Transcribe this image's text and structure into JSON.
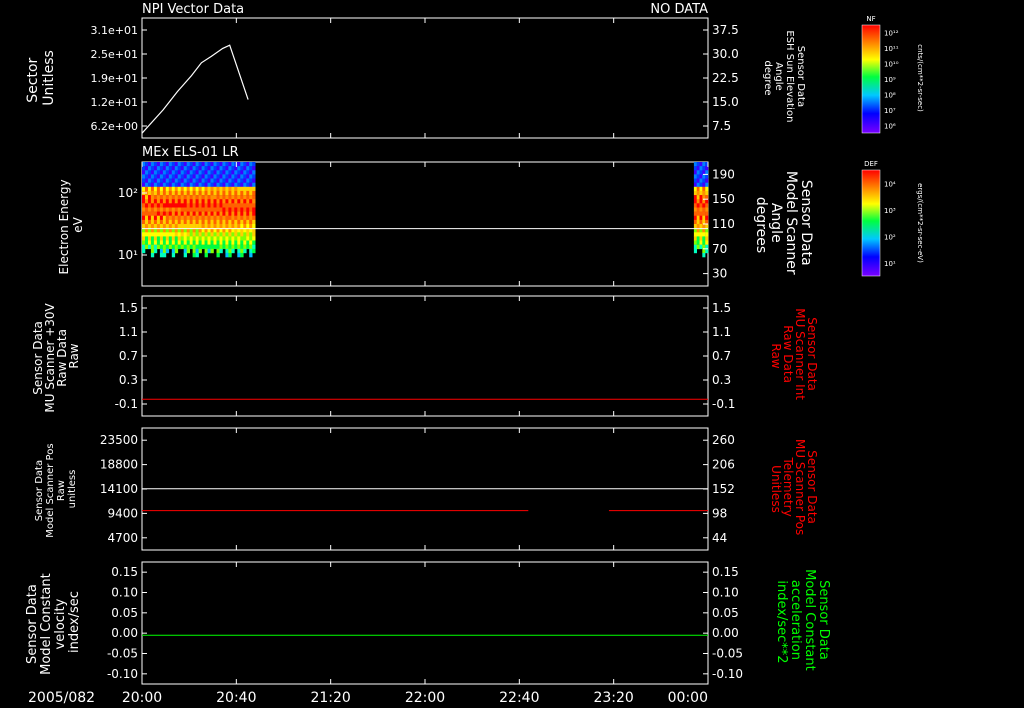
{
  "figure": {
    "date": "2005/082",
    "time_ticks": [
      "20:00",
      "20:40",
      "21:20",
      "22:00",
      "22:40",
      "23:20",
      "00:00"
    ]
  },
  "chart_data": [
    {
      "type": "line",
      "title": "NPI Vector Data",
      "status": "NO DATA",
      "ylabel_left": [
        "Sector",
        "Unitless"
      ],
      "yticks_left": [
        "3.1e+01",
        "2.5e+01",
        "1.9e+01",
        "1.2e+01",
        "6.2e+00"
      ],
      "ylabel_right": [
        "Sensor Data",
        "ESH Sun Elevation",
        "Angle",
        "degree"
      ],
      "yticks_right": [
        "37.5",
        "30.0",
        "22.5",
        "15.0",
        "7.5"
      ],
      "ylim_right": [
        0,
        37.5
      ],
      "series": [
        {
          "color": "#ffffff",
          "x": [
            0,
            0.15,
            0.25,
            0.35,
            0.42,
            0.49,
            0.57,
            0.62,
            0.75
          ],
          "y": [
            1.5,
            8.8,
            14.5,
            19.5,
            23.5,
            25.5,
            28.0,
            29.0,
            12.0
          ]
        }
      ]
    },
    {
      "type": "heatmap",
      "title": "MEx ELS-01 LR",
      "ylabel_left": [
        "Electron Energy",
        "eV"
      ],
      "yticks_left": [
        "10²",
        "10¹"
      ],
      "ylabel_right": [
        "Sensor Data",
        "Model Scanner",
        "Angle",
        "degrees"
      ],
      "yticks_right": [
        "190",
        "150",
        "110",
        "70",
        "30"
      ],
      "ylim_right": [
        0,
        190
      ],
      "data_blocks": [
        {
          "x_start": 0.0,
          "x_end": 0.8,
          "color_profile": "spectrum"
        },
        {
          "x_start": 3.9,
          "x_end": 4.0,
          "color_profile": "spectrum"
        }
      ],
      "series": [
        {
          "color": "#ffffff",
          "y": 88
        }
      ]
    },
    {
      "type": "line",
      "ylabel_left": [
        "Sensor Data",
        "MU Scanner +30V",
        "Raw Data",
        "Raw"
      ],
      "yticks_left": [
        "1.5",
        "1.1",
        "0.7",
        "0.3",
        "-0.1"
      ],
      "ylim": [
        -0.5,
        1.5
      ],
      "ylabel_right": [
        "Sensor Data",
        "MU Scanner Int",
        "Raw Data",
        "Raw"
      ],
      "yticks_right": [
        "1.5",
        "1.1",
        "0.7",
        "0.3",
        "-0.1"
      ],
      "series": [
        {
          "color": "#ff0000",
          "segments": [
            [
              0,
              4,
              -0.22
            ]
          ]
        }
      ]
    },
    {
      "type": "line",
      "ylabel_left": [
        "Sensor Data",
        "Model Scanner Pos",
        "Raw",
        "unitless"
      ],
      "yticks_left": [
        "23500",
        "18800",
        "14100",
        "9400",
        "4700"
      ],
      "ylim_left": [
        0,
        23500
      ],
      "ylabel_right": [
        "Sensor Data",
        "MU Scanner Pos",
        "Telemetry",
        "Unitless"
      ],
      "yticks_right": [
        "260",
        "206",
        "152",
        "98",
        "44"
      ],
      "ylim_right": [
        0,
        260
      ],
      "series": [
        {
          "color": "#ffffff",
          "axis": "left",
          "segments": [
            [
              0,
              4,
              11800
            ]
          ]
        },
        {
          "color": "#ff0000",
          "axis": "right",
          "segments": [
            [
              0,
              2.73,
              84
            ],
            [
              3.3,
              4,
              84
            ]
          ]
        }
      ]
    },
    {
      "type": "line",
      "ylabel_left": [
        "Sensor Data",
        "Model Constant",
        "velocity",
        "index/sec"
      ],
      "yticks_left": [
        "0.15",
        "0.10",
        "0.05",
        "0.00",
        "-0.05",
        "-0.10"
      ],
      "ylim": [
        -0.1,
        0.15
      ],
      "ylabel_right": [
        "Sensor Data",
        "Model Constant",
        "acceleration",
        "index/sec**2"
      ],
      "yticks_right": [
        "0.15",
        "0.10",
        "0.05",
        "0.00",
        "-0.05",
        "-0.10"
      ],
      "series": [
        {
          "color": "#00ff00",
          "segments": [
            [
              0,
              4,
              0.0
            ]
          ]
        }
      ]
    }
  ],
  "colorbars": [
    {
      "label": "NF",
      "units": "cnts/(cm**2-sr-sec)",
      "ticks": [
        "10¹²",
        "10¹¹",
        "10¹⁰",
        "10⁹",
        "10⁸",
        "10⁷",
        "10⁶"
      ]
    },
    {
      "label": "DEF",
      "units": "ergs/(cm**2-sr-sec-eV)",
      "ticks": [
        "10⁴",
        "10³",
        "10²",
        "10¹"
      ]
    }
  ],
  "colors": {
    "white": "#ffffff",
    "red": "#ff0000",
    "green": "#00ff00"
  }
}
